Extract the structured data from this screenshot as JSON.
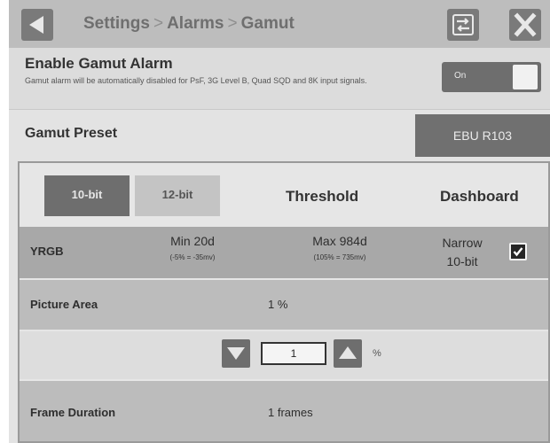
{
  "header": {
    "breadcrumb": [
      "Settings",
      "Alarms",
      "Gamut"
    ],
    "separator": ">"
  },
  "enable_alarm": {
    "title": "Enable Gamut Alarm",
    "description": "Gamut alarm will be automatically disabled for PsF, 3G Level B, Quad SQD and 8K input signals.",
    "toggle_label": "On",
    "enabled": true
  },
  "preset": {
    "title": "Gamut Preset",
    "value": "EBU R103"
  },
  "table": {
    "tabs": [
      "10-bit",
      "12-bit"
    ],
    "selected_tab": "10-bit",
    "col_threshold": "Threshold",
    "col_dashboard": "Dashboard",
    "yrgb": {
      "label": "YRGB",
      "min_main": "Min 20d",
      "min_sub": "(-5% = -35mv)",
      "max_main": "Max 984d",
      "max_sub": "(105% = 735mv)",
      "dashboard_mode_1": "Narrow",
      "dashboard_mode_2": "10-bit",
      "dashboard_checked": true
    },
    "picture_area": {
      "label": "Picture Area",
      "value": "1 %"
    },
    "stepper": {
      "value": "1",
      "unit": "%"
    },
    "frame_duration": {
      "label": "Frame Duration",
      "value": "1 frames"
    }
  },
  "colors": {
    "header_bg": "#bdbdbd",
    "button_bg": "#7a7a7a",
    "panel_bg": "#e6e6e6",
    "row_dark": "#a8a8a8",
    "row_mid": "#bcbcbc"
  }
}
